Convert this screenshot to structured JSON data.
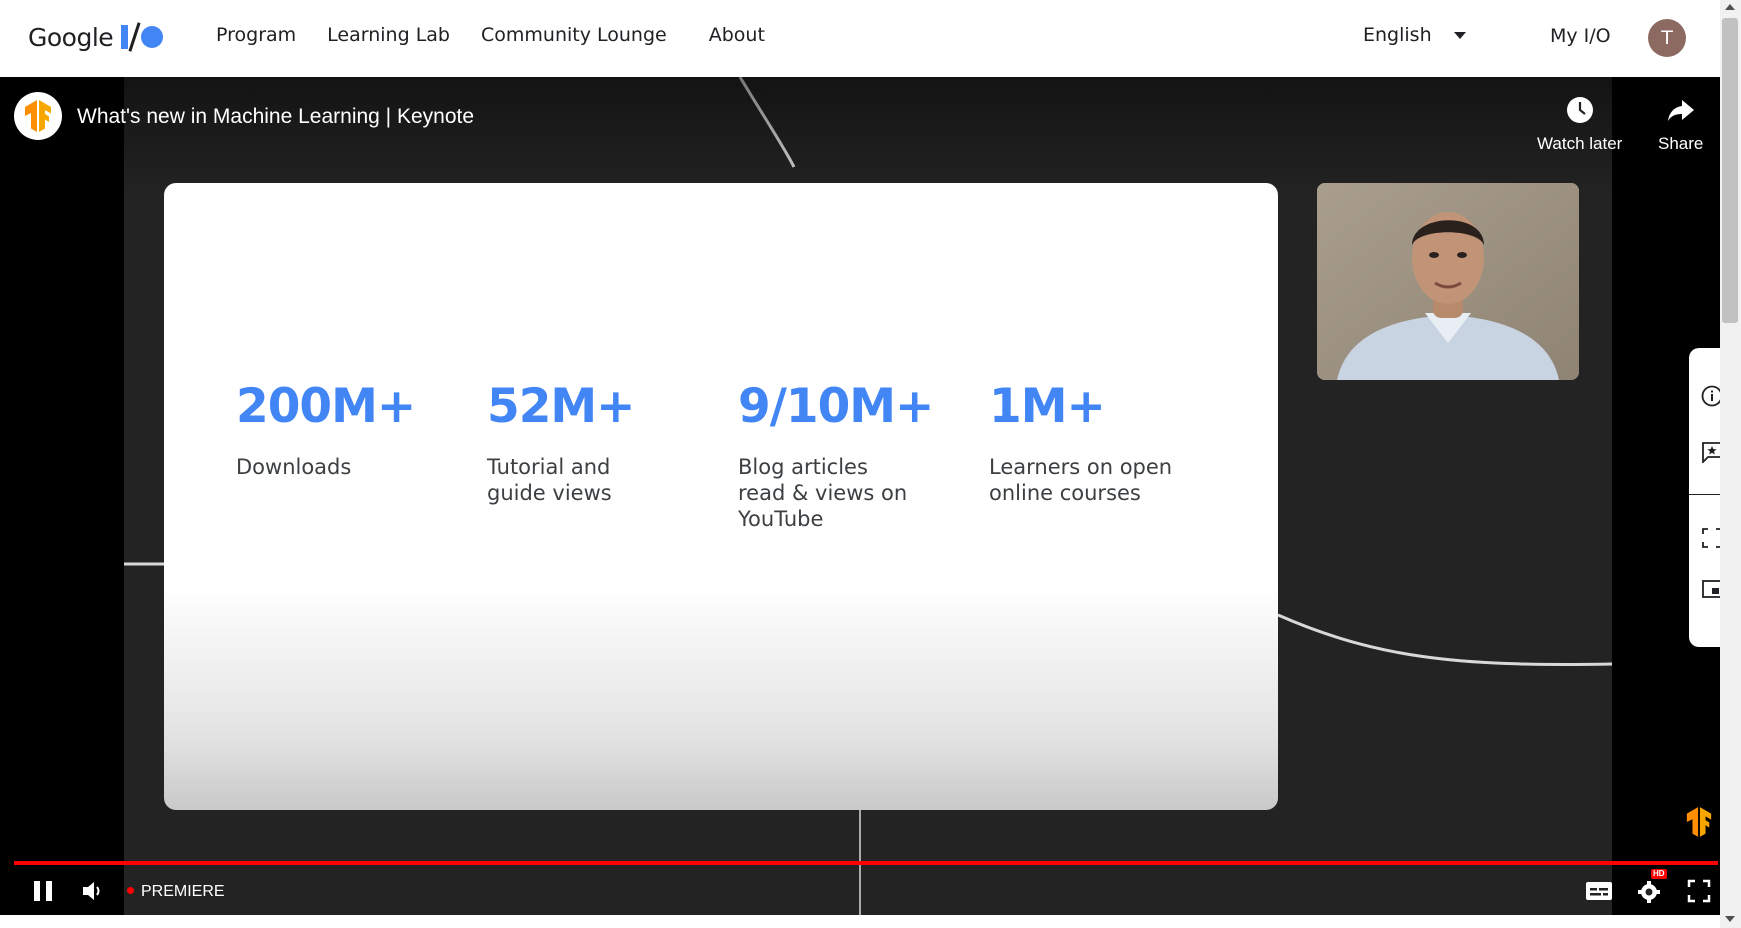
{
  "header": {
    "logo_text": "Google",
    "nav": [
      "Program",
      "Learning Lab",
      "Community Lounge",
      "About"
    ],
    "language": "English",
    "my_io": "My I/O",
    "avatar_initial": "T"
  },
  "player": {
    "title": "What's new in Machine Learning | Keynote",
    "watch_later": "Watch later",
    "share": "Share",
    "premiere": "PREMIERE",
    "progress_fraction": 1.0,
    "hd_badge": "HD"
  },
  "slide": {
    "stats": [
      {
        "value": "200M+",
        "label_lines": [
          "Downloads"
        ]
      },
      {
        "value": "52M+",
        "label_lines": [
          "Tutorial and",
          "guide views"
        ]
      },
      {
        "value": "9/10M+",
        "label_lines": [
          "Blog articles",
          "read & views on",
          "YouTube"
        ]
      },
      {
        "value": "1M+",
        "label_lines": [
          "Learners on open",
          "online courses"
        ]
      }
    ]
  },
  "colors": {
    "accent_blue": "#4285f4",
    "progress_red": "#ff0000",
    "tensorflow_orange": "#ff8f00",
    "avatar_bg": "#8d6a61"
  },
  "icons": {
    "watch_later": "clock-icon",
    "share": "share-arrow-icon",
    "pause": "pause-icon",
    "volume": "volume-icon",
    "captions": "captions-icon",
    "settings": "gear-icon",
    "fullscreen": "fullscreen-icon"
  }
}
